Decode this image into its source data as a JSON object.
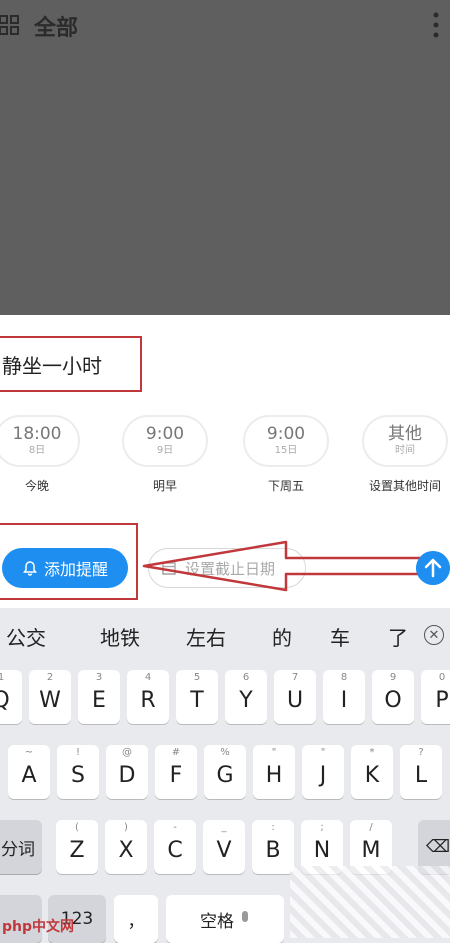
{
  "header": {
    "title": "全部",
    "grid_icon": "grid-icon",
    "more_icon": "more-vert-icon"
  },
  "task": {
    "text": "静坐一小时"
  },
  "quick_options": [
    {
      "time": "18:00",
      "sub": "8日",
      "label": "今晚"
    },
    {
      "time": "9:00",
      "sub": "9日",
      "label": "明早"
    },
    {
      "time": "9:00",
      "sub": "15日",
      "label": "下周五"
    },
    {
      "time": "其他",
      "sub": "时间",
      "label": "设置其他时间"
    }
  ],
  "remind_button": {
    "label": "添加提醒",
    "icon": "bell-icon"
  },
  "deadline": {
    "label": "设置截止日期",
    "icon": "calendar-icon"
  },
  "send_icon": "arrow-up-icon",
  "suggestions": [
    "公交",
    "地铁",
    "左右",
    "的",
    "车",
    "了"
  ],
  "keyboard": {
    "row1": [
      {
        "hint": "1",
        "key": "Q"
      },
      {
        "hint": "2",
        "key": "W"
      },
      {
        "hint": "3",
        "key": "E"
      },
      {
        "hint": "4",
        "key": "R"
      },
      {
        "hint": "5",
        "key": "T"
      },
      {
        "hint": "6",
        "key": "Y"
      },
      {
        "hint": "7",
        "key": "U"
      },
      {
        "hint": "8",
        "key": "I"
      },
      {
        "hint": "9",
        "key": "O"
      },
      {
        "hint": "0",
        "key": "P"
      }
    ],
    "row2": [
      {
        "hint": "~",
        "key": "A"
      },
      {
        "hint": "!",
        "key": "S"
      },
      {
        "hint": "@",
        "key": "D"
      },
      {
        "hint": "#",
        "key": "F"
      },
      {
        "hint": "%",
        "key": "G"
      },
      {
        "hint": "\"",
        "key": "H"
      },
      {
        "hint": "\"",
        "key": "J"
      },
      {
        "hint": "*",
        "key": "K"
      },
      {
        "hint": "?",
        "key": "L"
      }
    ],
    "row3": [
      {
        "hint": "(",
        "key": "Z"
      },
      {
        "hint": ")",
        "key": "X"
      },
      {
        "hint": "-",
        "key": "C"
      },
      {
        "hint": "_",
        "key": "V"
      },
      {
        "hint": ":",
        "key": "B"
      },
      {
        "hint": ";",
        "key": "N"
      },
      {
        "hint": "/",
        "key": "M"
      }
    ],
    "segment_label": "分词",
    "num_label": "123",
    "comma_label": "，",
    "space_label": "空格",
    "mic_icon": "microphone-icon",
    "backspace_icon": "backspace-icon"
  },
  "watermark": {
    "text": "php中文网"
  },
  "colors": {
    "accent": "#1e8ef0",
    "annotation_red": "#c0383c",
    "overlay": "#5f5f5f"
  }
}
